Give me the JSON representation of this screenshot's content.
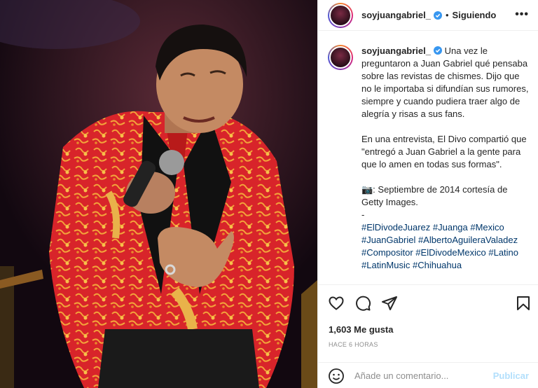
{
  "post": {
    "username": "soyjuangabriel_",
    "follow_status": "Siguiendo",
    "separator": "•",
    "avatar_text": "Juan Gabriel",
    "caption": "Una vez le preguntaron a Juan Gabriel qué pensaba sobre las revistas de chismes. Dijo que no le importaba si difundían sus rumores, siempre y cuando pudiera traer algo de alegría y risas a sus fans.\n\nEn una entrevista, El Divo compartió que \"entregó a Juan Gabriel a la gente para que lo amen en todas sus formas\".\n\n📷: Septiembre de 2014 cortesía de Getty Images.\n-",
    "hashtags": "#ElDivodeJuarez #Juanga #Mexico #JuanGabriel #AlbertoAguileraValadez #Compositor #ElDivodeMexico #Latino #LatinMusic #Chihuahua",
    "likes": "1,603 Me gusta",
    "time": "HACE 6 HORAS",
    "comment_placeholder": "Añade un comentario...",
    "publish_label": "Publicar"
  },
  "icons": {
    "more": "more-options-icon",
    "verified": "verified-badge-icon",
    "like": "heart-icon",
    "comment": "comment-icon",
    "share": "share-icon",
    "save": "bookmark-icon",
    "emoji": "emoji-icon"
  },
  "colors": {
    "verified": "#3897f0",
    "hashtag": "#00376b",
    "publish_disabled": "#b2dffc",
    "muted": "#8e8e8e"
  }
}
